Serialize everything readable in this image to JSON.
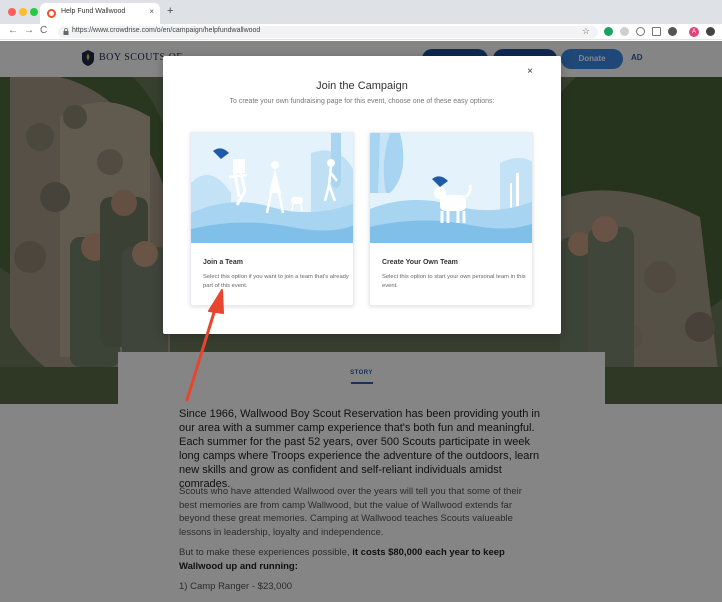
{
  "browser": {
    "tab_title": "Help Fund Wallwood",
    "tab_close": "×",
    "new_tab": "+",
    "url": "https://www.crowdrise.com/o/en/campaign/helpfundwallwood",
    "star": "☆",
    "profile_initial": "A",
    "nav": {
      "back": "←",
      "forward": "→",
      "reload": "C"
    }
  },
  "site": {
    "logo_text": "BOY SCOUTS OF",
    "donate_label": "Donate",
    "ad_label": "AD"
  },
  "modal": {
    "title": "Join the Campaign",
    "subtitle": "To create your own fundraising page for this event, choose one of these easy options:",
    "close": "×",
    "options": [
      {
        "title": "Join a Team",
        "description": "Select this option if you want to join a team that's already part of this event."
      },
      {
        "title": "Create Your Own Team",
        "description": "Select this option to start your own personal team in this event."
      }
    ]
  },
  "story": {
    "tab": "STORY",
    "lead": "Since 1966, Wallwood Boy Scout Reservation has been providing youth in our area with a summer camp experience that's both fun and meaningful. Each summer for the past 52 years, over 500 Scouts participate in week long camps where Troops experience the adventure of the outdoors, learn new skills and grow as confident and self-reliant individuals amidst comrades.",
    "p1": "Scouts who have attended Wallwood over the years will tell you that some of their best memories are from camp Wallwood, but the value of Wallwood extends far beyond these great memories. Camping at Wallwood teaches Scouts valueable lessons in leadership, loyalty and independence.",
    "p2_prefix": "But to make these experiences possible, ",
    "p2_bold": "it costs $80,000 each year to keep Wallwood up and running:",
    "p3": "1) Camp Ranger - $23,000"
  },
  "colors": {
    "accent": "#3d8ae6",
    "arrow": "#e8452f",
    "navy": "#1f4f9c"
  }
}
